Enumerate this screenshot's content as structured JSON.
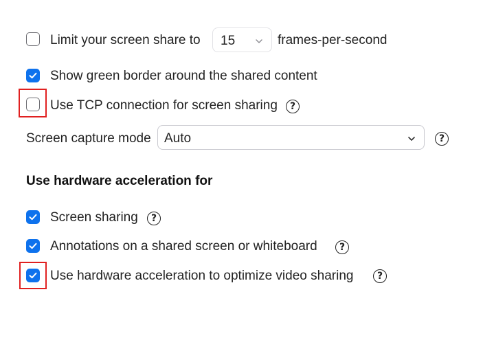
{
  "limit_fps": {
    "checked": false,
    "label_prefix": "Limit your screen share to",
    "value": "15",
    "label_suffix": "frames-per-second"
  },
  "green_border": {
    "checked": true,
    "label": "Show green border around the shared content"
  },
  "tcp_connection": {
    "checked": false,
    "label": "Use TCP connection for screen sharing"
  },
  "capture_mode": {
    "label": "Screen capture mode",
    "value": "Auto"
  },
  "hardware_acceleration": {
    "title": "Use hardware acceleration for",
    "items": [
      {
        "label": "Screen sharing",
        "checked": true
      },
      {
        "label": "Annotations on a shared screen or whiteboard",
        "checked": true
      },
      {
        "label": "Use hardware acceleration to optimize video sharing",
        "checked": true
      }
    ]
  },
  "colors": {
    "accent": "#0e72ed",
    "highlight": "#e02020"
  },
  "icons": {
    "help": "?",
    "chevron": "chevron-down-icon",
    "check": "checkmark-icon"
  }
}
